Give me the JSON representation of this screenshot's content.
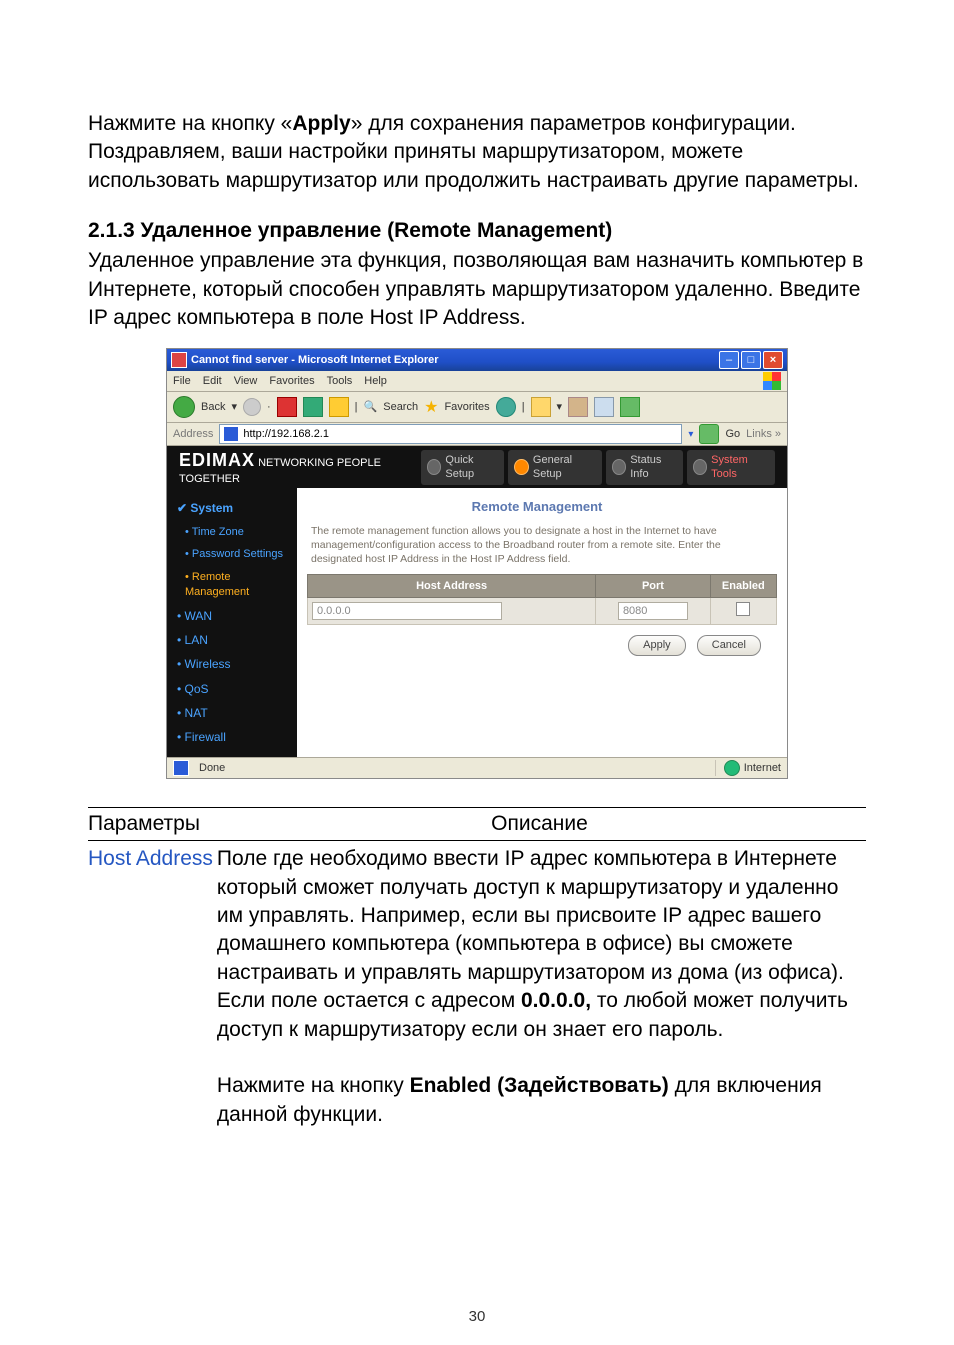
{
  "intro_pre": "Нажмите на кнопку «",
  "intro_bold": "Apply",
  "intro_post": "» для сохранения параметров конфигурации. Поздравляем, ваши настройки приняты маршрутизатором, можете использовать маршрутизатор или продолжить настраивать другие параметры.",
  "section_heading": "2.1.3  Удаленное управление (Remote Management)",
  "section_body": "Удаленное управление эта функция,  позволяющая вам назначить компьютер в Интернете, который способен управлять маршрутизатором удаленно. Введите IP адрес компьютера в поле Host IP Address.",
  "window_title": "Cannot find server - Microsoft Internet Explorer",
  "menus": [
    "File",
    "Edit",
    "View",
    "Favorites",
    "Tools",
    "Help"
  ],
  "tb_back": "Back",
  "tb_search": "Search",
  "tb_fav": "Favorites",
  "addr_label": "Address",
  "addr_url": "http://192.168.2.1",
  "go_text": "Go",
  "links_text": "Links »",
  "logo": "EDIMAX",
  "logo_sub": "NETWORKING PEOPLE TOGETHER",
  "crumbs": [
    "Quick Setup",
    "General Setup",
    "Status Info",
    "System Tools"
  ],
  "sidemenu_header": "System",
  "sidemenu_sub": [
    "Time Zone",
    "Password Settings",
    "Remote Management"
  ],
  "sidemenu_items": [
    "WAN",
    "LAN",
    "Wireless",
    "QoS",
    "NAT",
    "Firewall"
  ],
  "panel_title": "Remote Management",
  "panel_desc": "The remote management function allows you to designate a host in the Internet to have management/configuration access to the Broadband router from a remote site. Enter the designated host IP Address in the Host IP Address field.",
  "columns": {
    "host": "Host Address",
    "port": "Port",
    "enabled": "Enabled"
  },
  "row": {
    "host": "0.0.0.0",
    "port": "8080"
  },
  "btn_apply": "Apply",
  "btn_cancel": "Cancel",
  "status_done": "Done",
  "status_net": "Internet",
  "table_headers": {
    "p": "Параметры",
    "d": "Описание"
  },
  "param_host": "Host Address",
  "desc_host_pre": "Поле где необходимо ввести IP адрес компьютера в Интернете который сможет получать доступ к маршрутизатору и удаленно им управлять. Например, если вы присвоите IP адрес вашего домашнего компьютера (компьютера в офисе) вы сможете настраивать и управлять маршрутизатором из дома (из офиса). Если поле остается с адресом ",
  "desc_host_bold1": "0.0.0.0,",
  "desc_host_post": " то любой может получить доступ к маршрутизатору если он знает его пароль.",
  "desc_host_2_pre": "Нажмите на кнопку ",
  "desc_host_2_bold": "Enabled (Задействовать)",
  "desc_host_2_post": " для включения данной функции.",
  "page_number": "30",
  "chart_data": {
    "type": "table",
    "columns": [
      "Host Address",
      "Port",
      "Enabled"
    ],
    "rows": [
      [
        "0.0.0.0",
        "8080",
        false
      ]
    ]
  }
}
